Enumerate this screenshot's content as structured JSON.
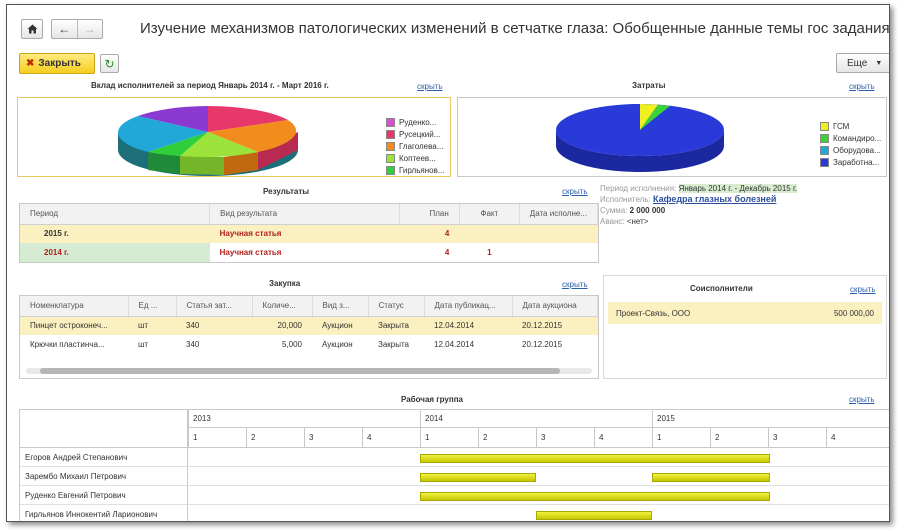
{
  "window": {
    "title": "Изучение механизмов патологических изменений в сетчатке глаза: Обобщенные данные темы гос задания"
  },
  "toolbar": {
    "close_label": "Закрыть",
    "more_label": "Еще"
  },
  "hide_label": "скрыть",
  "contribution": {
    "title": "Вклад исполнителей за период Январь 2014 г. - Март 2016 г.",
    "legend": [
      {
        "label": "Руденко...",
        "color": "#d94fd1"
      },
      {
        "label": "Русецкий...",
        "color": "#e8386b"
      },
      {
        "label": "Глаголева...",
        "color": "#f28c1c"
      },
      {
        "label": "Коптеев...",
        "color": "#9be33a"
      },
      {
        "label": "Гирльянов...",
        "color": "#2fcf3c"
      }
    ]
  },
  "costs": {
    "title": "Затраты",
    "legend": [
      {
        "label": "ГСМ",
        "color": "#f0f020"
      },
      {
        "label": "Командиро...",
        "color": "#3cd23c"
      },
      {
        "label": "Оборудова...",
        "color": "#22a8d8"
      },
      {
        "label": "Заработна...",
        "color": "#2a3ad8"
      }
    ]
  },
  "results": {
    "title": "Результаты",
    "columns": [
      "Период",
      "Вид результата",
      "План",
      "Факт",
      "Дата исполне..."
    ],
    "rows": [
      {
        "period": "2015 г.",
        "type": "Научная статья",
        "plan": "4",
        "fact": "",
        "date": ""
      },
      {
        "period": "2014 г.",
        "type": "Научная статья",
        "plan": "4",
        "fact": "1",
        "date": ""
      }
    ]
  },
  "info": {
    "period_label": "Период исполнения:",
    "period_value": "Январь 2014 г. - Декабрь 2015 г.",
    "executor_label": "Исполнитель:",
    "executor_value": "Кафедра глазных болезней",
    "sum_label": "Сумма:",
    "sum_value": "2 000 000",
    "advance_label": "Аванс:",
    "advance_value": "<нет>"
  },
  "purchase": {
    "title": "Закупка",
    "columns": [
      "Номенклатура",
      "Ед ...",
      "Статья зат...",
      "Количе...",
      "Вид з...",
      "Статус",
      "Дата публикац...",
      "Дата аукциона"
    ],
    "rows": [
      {
        "name": "Пинцет остроконеч...",
        "unit": "шт",
        "article": "340",
        "qty": "20,000",
        "kind": "Аукцион",
        "status": "Закрыта",
        "pub": "12.04.2014",
        "auction": "20.12.2015"
      },
      {
        "name": "Крючки пластинча...",
        "unit": "шт",
        "article": "340",
        "qty": "5,000",
        "kind": "Аукцион",
        "status": "Закрыта",
        "pub": "12.04.2014",
        "auction": "20.12.2015"
      }
    ]
  },
  "coexecutors": {
    "title": "Соисполнители",
    "rows": [
      {
        "name": "Проект-Связь, ООО",
        "amount": "500 000,00"
      }
    ]
  },
  "workgroup": {
    "title": "Рабочая группа",
    "years": [
      "2013",
      "2014",
      "2015"
    ],
    "quarters": [
      "1",
      "2",
      "3",
      "4",
      "1",
      "2",
      "3",
      "4",
      "1",
      "2",
      "3",
      "4"
    ],
    "members": [
      {
        "name": "Егоров Андрей Степанович"
      },
      {
        "name": "Зарембо Михаил Петрович"
      },
      {
        "name": "Руденко Евгений Петрович"
      },
      {
        "name": "Гирльянов Иннокентий Ларионович"
      }
    ]
  }
}
